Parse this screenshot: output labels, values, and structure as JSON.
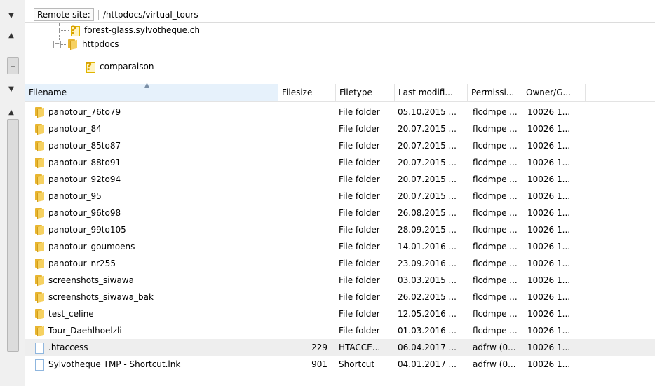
{
  "remote_site": {
    "label": "Remote site:",
    "path": "/httpdocs/virtual_tours"
  },
  "tree": {
    "items": [
      {
        "label": "forest-glass.sylvotheque.ch",
        "icon": "unknown-question-icon"
      },
      {
        "label": "httpdocs",
        "icon": "folder-icon"
      },
      {
        "label": "comparaison",
        "icon": "unknown-question-icon"
      }
    ]
  },
  "columns": {
    "filename": "Filename",
    "filesize": "Filesize",
    "filetype": "Filetype",
    "last_modified": "Last modifi...",
    "permissions": "Permissi...",
    "owner": "Owner/G..."
  },
  "files": [
    {
      "name": "panotour_76to79",
      "size": "",
      "type": "File folder",
      "modified": "05.10.2015 ...",
      "perm": "flcdmpe ...",
      "owner": "10026 1...",
      "icon": "folder-icon"
    },
    {
      "name": "panotour_84",
      "size": "",
      "type": "File folder",
      "modified": "20.07.2015 ...",
      "perm": "flcdmpe ...",
      "owner": "10026 1...",
      "icon": "folder-icon"
    },
    {
      "name": "panotour_85to87",
      "size": "",
      "type": "File folder",
      "modified": "20.07.2015 ...",
      "perm": "flcdmpe ...",
      "owner": "10026 1...",
      "icon": "folder-icon"
    },
    {
      "name": "panotour_88to91",
      "size": "",
      "type": "File folder",
      "modified": "20.07.2015 ...",
      "perm": "flcdmpe ...",
      "owner": "10026 1...",
      "icon": "folder-icon"
    },
    {
      "name": "panotour_92to94",
      "size": "",
      "type": "File folder",
      "modified": "20.07.2015 ...",
      "perm": "flcdmpe ...",
      "owner": "10026 1...",
      "icon": "folder-icon"
    },
    {
      "name": "panotour_95",
      "size": "",
      "type": "File folder",
      "modified": "20.07.2015 ...",
      "perm": "flcdmpe ...",
      "owner": "10026 1...",
      "icon": "folder-icon"
    },
    {
      "name": "panotour_96to98",
      "size": "",
      "type": "File folder",
      "modified": "26.08.2015 ...",
      "perm": "flcdmpe ...",
      "owner": "10026 1...",
      "icon": "folder-icon"
    },
    {
      "name": "panotour_99to105",
      "size": "",
      "type": "File folder",
      "modified": "28.09.2015 ...",
      "perm": "flcdmpe ...",
      "owner": "10026 1...",
      "icon": "folder-icon"
    },
    {
      "name": "panotour_goumoens",
      "size": "",
      "type": "File folder",
      "modified": "14.01.2016 ...",
      "perm": "flcdmpe ...",
      "owner": "10026 1...",
      "icon": "folder-icon"
    },
    {
      "name": "panotour_nr255",
      "size": "",
      "type": "File folder",
      "modified": "23.09.2016 ...",
      "perm": "flcdmpe ...",
      "owner": "10026 1...",
      "icon": "folder-icon"
    },
    {
      "name": "screenshots_siwawa",
      "size": "",
      "type": "File folder",
      "modified": "03.03.2015 ...",
      "perm": "flcdmpe ...",
      "owner": "10026 1...",
      "icon": "folder-icon"
    },
    {
      "name": "screenshots_siwawa_bak",
      "size": "",
      "type": "File folder",
      "modified": "26.02.2015 ...",
      "perm": "flcdmpe ...",
      "owner": "10026 1...",
      "icon": "folder-icon"
    },
    {
      "name": "test_celine",
      "size": "",
      "type": "File folder",
      "modified": "12.05.2016 ...",
      "perm": "flcdmpe ...",
      "owner": "10026 1...",
      "icon": "folder-icon"
    },
    {
      "name": "Tour_Daehlhoelzli",
      "size": "",
      "type": "File folder",
      "modified": "01.03.2016 ...",
      "perm": "flcdmpe ...",
      "owner": "10026 1...",
      "icon": "folder-icon"
    },
    {
      "name": ".htaccess",
      "size": "229",
      "type": "HTACCE...",
      "modified": "06.04.2017 ...",
      "perm": "adfrw (0...",
      "owner": "10026 1...",
      "icon": "file-icon",
      "selected": true
    },
    {
      "name": "Sylvotheque TMP - Shortcut.lnk",
      "size": "901",
      "type": "Shortcut",
      "modified": "04.01.2017 ...",
      "perm": "adfrw (0...",
      "owner": "10026 1...",
      "icon": "file-icon"
    }
  ]
}
